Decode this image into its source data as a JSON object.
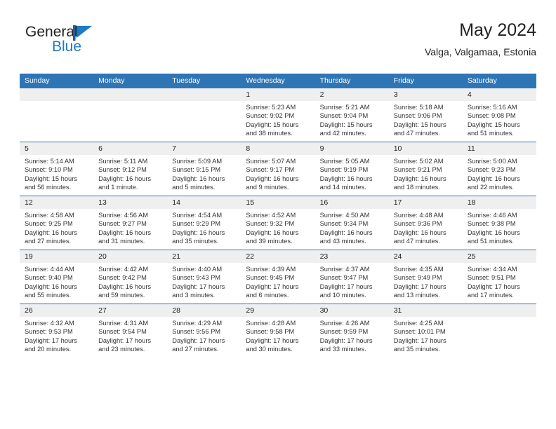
{
  "logo": {
    "word_one": "General",
    "word_two": "Blue",
    "flag_icon": "blue-flag-triangle",
    "accent_color": "#1d7cc4"
  },
  "header": {
    "title": "May 2024",
    "subtitle": "Valga, Valgamaa, Estonia"
  },
  "calendar": {
    "header_color": "#2e75b6",
    "daynum_band_color": "#efefef",
    "weekday_headers": [
      "Sunday",
      "Monday",
      "Tuesday",
      "Wednesday",
      "Thursday",
      "Friday",
      "Saturday"
    ],
    "weeks": [
      [
        {
          "day": "",
          "empty": true,
          "sunrise": "",
          "sunset": "",
          "daylight_line1": "",
          "daylight_line2": ""
        },
        {
          "day": "",
          "empty": true,
          "sunrise": "",
          "sunset": "",
          "daylight_line1": "",
          "daylight_line2": ""
        },
        {
          "day": "",
          "empty": true,
          "sunrise": "",
          "sunset": "",
          "daylight_line1": "",
          "daylight_line2": ""
        },
        {
          "day": "1",
          "empty": false,
          "sunrise": "Sunrise: 5:23 AM",
          "sunset": "Sunset: 9:02 PM",
          "daylight_line1": "Daylight: 15 hours",
          "daylight_line2": "and 38 minutes."
        },
        {
          "day": "2",
          "empty": false,
          "sunrise": "Sunrise: 5:21 AM",
          "sunset": "Sunset: 9:04 PM",
          "daylight_line1": "Daylight: 15 hours",
          "daylight_line2": "and 42 minutes."
        },
        {
          "day": "3",
          "empty": false,
          "sunrise": "Sunrise: 5:18 AM",
          "sunset": "Sunset: 9:06 PM",
          "daylight_line1": "Daylight: 15 hours",
          "daylight_line2": "and 47 minutes."
        },
        {
          "day": "4",
          "empty": false,
          "sunrise": "Sunrise: 5:16 AM",
          "sunset": "Sunset: 9:08 PM",
          "daylight_line1": "Daylight: 15 hours",
          "daylight_line2": "and 51 minutes."
        }
      ],
      [
        {
          "day": "5",
          "empty": false,
          "sunrise": "Sunrise: 5:14 AM",
          "sunset": "Sunset: 9:10 PM",
          "daylight_line1": "Daylight: 15 hours",
          "daylight_line2": "and 56 minutes."
        },
        {
          "day": "6",
          "empty": false,
          "sunrise": "Sunrise: 5:11 AM",
          "sunset": "Sunset: 9:12 PM",
          "daylight_line1": "Daylight: 16 hours",
          "daylight_line2": "and 1 minute."
        },
        {
          "day": "7",
          "empty": false,
          "sunrise": "Sunrise: 5:09 AM",
          "sunset": "Sunset: 9:15 PM",
          "daylight_line1": "Daylight: 16 hours",
          "daylight_line2": "and 5 minutes."
        },
        {
          "day": "8",
          "empty": false,
          "sunrise": "Sunrise: 5:07 AM",
          "sunset": "Sunset: 9:17 PM",
          "daylight_line1": "Daylight: 16 hours",
          "daylight_line2": "and 9 minutes."
        },
        {
          "day": "9",
          "empty": false,
          "sunrise": "Sunrise: 5:05 AM",
          "sunset": "Sunset: 9:19 PM",
          "daylight_line1": "Daylight: 16 hours",
          "daylight_line2": "and 14 minutes."
        },
        {
          "day": "10",
          "empty": false,
          "sunrise": "Sunrise: 5:02 AM",
          "sunset": "Sunset: 9:21 PM",
          "daylight_line1": "Daylight: 16 hours",
          "daylight_line2": "and 18 minutes."
        },
        {
          "day": "11",
          "empty": false,
          "sunrise": "Sunrise: 5:00 AM",
          "sunset": "Sunset: 9:23 PM",
          "daylight_line1": "Daylight: 16 hours",
          "daylight_line2": "and 22 minutes."
        }
      ],
      [
        {
          "day": "12",
          "empty": false,
          "sunrise": "Sunrise: 4:58 AM",
          "sunset": "Sunset: 9:25 PM",
          "daylight_line1": "Daylight: 16 hours",
          "daylight_line2": "and 27 minutes."
        },
        {
          "day": "13",
          "empty": false,
          "sunrise": "Sunrise: 4:56 AM",
          "sunset": "Sunset: 9:27 PM",
          "daylight_line1": "Daylight: 16 hours",
          "daylight_line2": "and 31 minutes."
        },
        {
          "day": "14",
          "empty": false,
          "sunrise": "Sunrise: 4:54 AM",
          "sunset": "Sunset: 9:29 PM",
          "daylight_line1": "Daylight: 16 hours",
          "daylight_line2": "and 35 minutes."
        },
        {
          "day": "15",
          "empty": false,
          "sunrise": "Sunrise: 4:52 AM",
          "sunset": "Sunset: 9:32 PM",
          "daylight_line1": "Daylight: 16 hours",
          "daylight_line2": "and 39 minutes."
        },
        {
          "day": "16",
          "empty": false,
          "sunrise": "Sunrise: 4:50 AM",
          "sunset": "Sunset: 9:34 PM",
          "daylight_line1": "Daylight: 16 hours",
          "daylight_line2": "and 43 minutes."
        },
        {
          "day": "17",
          "empty": false,
          "sunrise": "Sunrise: 4:48 AM",
          "sunset": "Sunset: 9:36 PM",
          "daylight_line1": "Daylight: 16 hours",
          "daylight_line2": "and 47 minutes."
        },
        {
          "day": "18",
          "empty": false,
          "sunrise": "Sunrise: 4:46 AM",
          "sunset": "Sunset: 9:38 PM",
          "daylight_line1": "Daylight: 16 hours",
          "daylight_line2": "and 51 minutes."
        }
      ],
      [
        {
          "day": "19",
          "empty": false,
          "sunrise": "Sunrise: 4:44 AM",
          "sunset": "Sunset: 9:40 PM",
          "daylight_line1": "Daylight: 16 hours",
          "daylight_line2": "and 55 minutes."
        },
        {
          "day": "20",
          "empty": false,
          "sunrise": "Sunrise: 4:42 AM",
          "sunset": "Sunset: 9:42 PM",
          "daylight_line1": "Daylight: 16 hours",
          "daylight_line2": "and 59 minutes."
        },
        {
          "day": "21",
          "empty": false,
          "sunrise": "Sunrise: 4:40 AM",
          "sunset": "Sunset: 9:43 PM",
          "daylight_line1": "Daylight: 17 hours",
          "daylight_line2": "and 3 minutes."
        },
        {
          "day": "22",
          "empty": false,
          "sunrise": "Sunrise: 4:39 AM",
          "sunset": "Sunset: 9:45 PM",
          "daylight_line1": "Daylight: 17 hours",
          "daylight_line2": "and 6 minutes."
        },
        {
          "day": "23",
          "empty": false,
          "sunrise": "Sunrise: 4:37 AM",
          "sunset": "Sunset: 9:47 PM",
          "daylight_line1": "Daylight: 17 hours",
          "daylight_line2": "and 10 minutes."
        },
        {
          "day": "24",
          "empty": false,
          "sunrise": "Sunrise: 4:35 AM",
          "sunset": "Sunset: 9:49 PM",
          "daylight_line1": "Daylight: 17 hours",
          "daylight_line2": "and 13 minutes."
        },
        {
          "day": "25",
          "empty": false,
          "sunrise": "Sunrise: 4:34 AM",
          "sunset": "Sunset: 9:51 PM",
          "daylight_line1": "Daylight: 17 hours",
          "daylight_line2": "and 17 minutes."
        }
      ],
      [
        {
          "day": "26",
          "empty": false,
          "sunrise": "Sunrise: 4:32 AM",
          "sunset": "Sunset: 9:53 PM",
          "daylight_line1": "Daylight: 17 hours",
          "daylight_line2": "and 20 minutes."
        },
        {
          "day": "27",
          "empty": false,
          "sunrise": "Sunrise: 4:31 AM",
          "sunset": "Sunset: 9:54 PM",
          "daylight_line1": "Daylight: 17 hours",
          "daylight_line2": "and 23 minutes."
        },
        {
          "day": "28",
          "empty": false,
          "sunrise": "Sunrise: 4:29 AM",
          "sunset": "Sunset: 9:56 PM",
          "daylight_line1": "Daylight: 17 hours",
          "daylight_line2": "and 27 minutes."
        },
        {
          "day": "29",
          "empty": false,
          "sunrise": "Sunrise: 4:28 AM",
          "sunset": "Sunset: 9:58 PM",
          "daylight_line1": "Daylight: 17 hours",
          "daylight_line2": "and 30 minutes."
        },
        {
          "day": "30",
          "empty": false,
          "sunrise": "Sunrise: 4:26 AM",
          "sunset": "Sunset: 9:59 PM",
          "daylight_line1": "Daylight: 17 hours",
          "daylight_line2": "and 33 minutes."
        },
        {
          "day": "31",
          "empty": false,
          "sunrise": "Sunrise: 4:25 AM",
          "sunset": "Sunset: 10:01 PM",
          "daylight_line1": "Daylight: 17 hours",
          "daylight_line2": "and 35 minutes."
        },
        {
          "day": "",
          "empty": true,
          "sunrise": "",
          "sunset": "",
          "daylight_line1": "",
          "daylight_line2": ""
        }
      ]
    ]
  }
}
